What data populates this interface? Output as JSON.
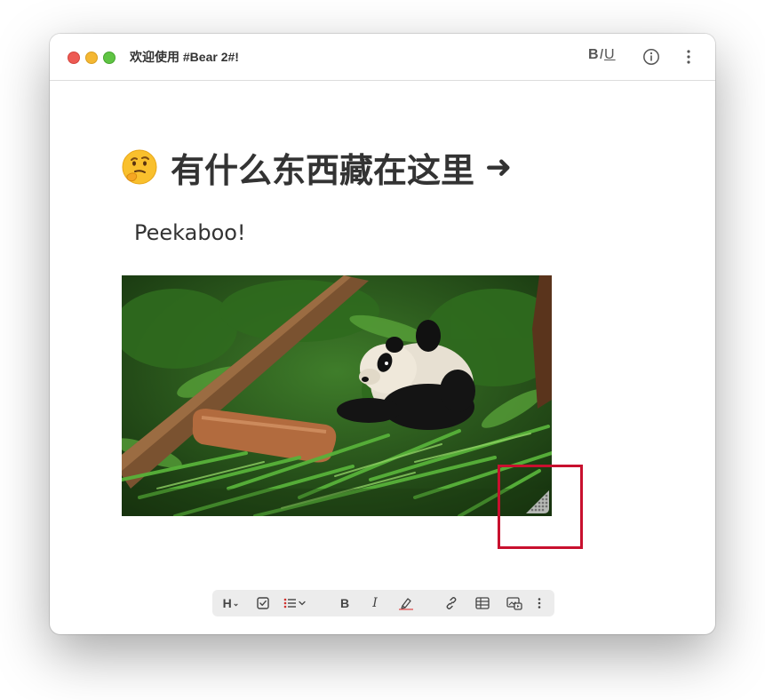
{
  "window": {
    "title": "欢迎使用 #Bear 2#!",
    "format_toggle": {
      "bold": "B",
      "italic": "I",
      "underline": "U"
    },
    "icons": [
      "info-icon",
      "more-vertical-icon"
    ]
  },
  "note": {
    "heading": "有什么东西藏在这里",
    "heading_prefix_icon": "thinking-face-emoji",
    "heading_suffix": "➜",
    "body": "Peekaboo!",
    "image": {
      "subject": "panda",
      "icon": "resize-handle-icon"
    }
  },
  "toolbar": {
    "heading_label": "H",
    "heading_chevron": "⌄",
    "bold_label": "B",
    "italic_label": "I",
    "icons": [
      "checkbox-icon",
      "list-icon",
      "highlighter-icon",
      "link-icon",
      "table-icon",
      "media-icon",
      "more-vertical-icon"
    ]
  },
  "colors": {
    "close": "#ed5a53",
    "minimize": "#f4b732",
    "maximize": "#5fc443",
    "highlight_box": "#c8102e",
    "list_accent": "#d0312d",
    "highlighter_accent": "#e05a5a"
  }
}
